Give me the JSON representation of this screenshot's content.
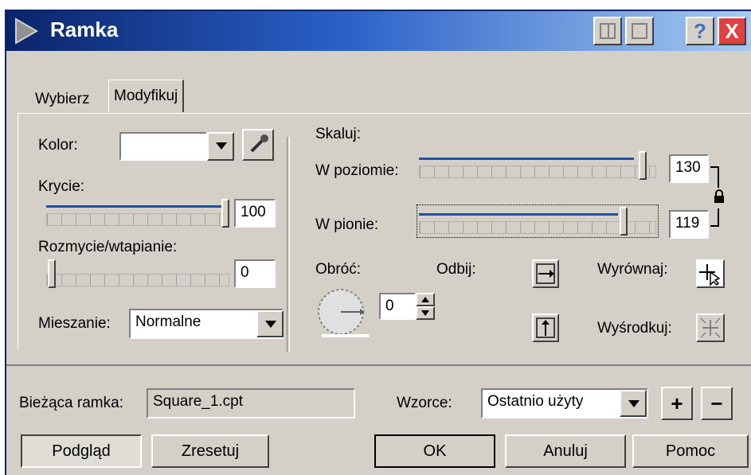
{
  "window": {
    "title": "Ramka"
  },
  "tabs": [
    {
      "label": "Wybierz"
    },
    {
      "label": "Modyfikuj"
    }
  ],
  "left": {
    "color_label": "Kolor:",
    "opacity_label": "Krycie:",
    "opacity_value": "100",
    "opacity_level": 1.0,
    "blur_label": "Rozmycie/wtapianie:",
    "blur_value": "0",
    "blend_label": "Mieszanie:",
    "blend_value": "Normalne"
  },
  "right": {
    "scale_label": "Skaluj:",
    "horizontal_label": "W poziomie:",
    "horizontal_value": "130",
    "vertical_label": "W pionie:",
    "vertical_value": "119",
    "rotate_label": "Obróć:",
    "rotate_value": "0",
    "flip_label": "Odbij:",
    "align_label": "Wyrównaj:",
    "center_label": "Wyśrodkuj:"
  },
  "bottom": {
    "current_frame_label": "Bieżąca ramka:",
    "current_frame_value": "Square_1.cpt",
    "presets_label": "Wzorce:",
    "presets_value": "Ostatnio użyty",
    "add_label": "+",
    "remove_label": "−",
    "preview_label": "Podgląd",
    "reset_label": "Zresetuj",
    "ok_label": "OK",
    "cancel_label": "Anuluj",
    "help_label": "Pomoc"
  },
  "titlebar_buttons": {
    "help": "?",
    "close": "X"
  }
}
